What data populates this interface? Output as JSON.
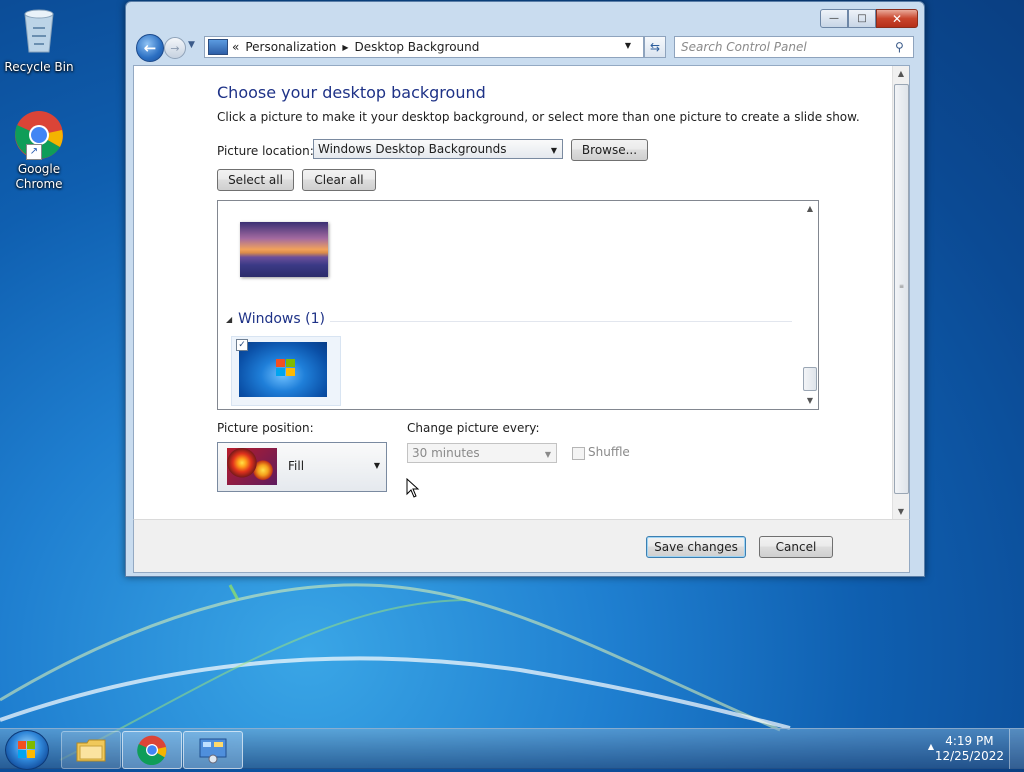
{
  "desktop": {
    "icons": [
      {
        "label": "Recycle Bin"
      },
      {
        "label": "Google Chrome"
      }
    ]
  },
  "window": {
    "controls": {
      "minimize": "—",
      "maximize": "□",
      "close": "✕"
    },
    "address": {
      "segments": [
        "Personalization",
        "Desktop Background"
      ],
      "separator": "▶",
      "prefix": "«"
    },
    "search": {
      "placeholder": "Search Control Panel"
    }
  },
  "main": {
    "title": "Choose your desktop background",
    "description": "Click a picture to make it your desktop background, or select more than one picture to create a slide show.",
    "picture_location_label": "Picture location:",
    "picture_location_value": "Windows Desktop Backgrounds",
    "browse_label": "Browse...",
    "select_all_label": "Select all",
    "clear_all_label": "Clear all",
    "gallery": {
      "group_title": "Windows (1)",
      "checked": true
    },
    "picture_position_label": "Picture position:",
    "picture_position_value": "Fill",
    "change_every_label": "Change picture every:",
    "change_every_value": "30 minutes",
    "shuffle_label": "Shuffle"
  },
  "footer": {
    "save_label": "Save changes",
    "cancel_label": "Cancel"
  },
  "taskbar": {
    "time": "4:19 PM",
    "date": "12/25/2022"
  }
}
